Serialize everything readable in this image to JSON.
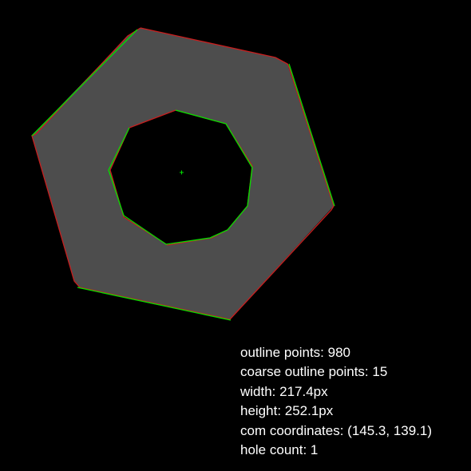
{
  "colors": {
    "background": "#000000",
    "shape_fill": "#4d4d4d",
    "outline": "#c81e1e",
    "coarse_outline": "#00e000",
    "centroid_marker": "#00e000",
    "text": "#ffffff"
  },
  "stats": {
    "outline_points": "outline points: 980",
    "coarse_outline_points": "coarse outline points: 15",
    "width": "width: 217.4px",
    "height": "height: 252.1px",
    "com_coordinates": "com coordinates: (145.3, 139.1)",
    "hole_count": "hole count: 1"
  }
}
